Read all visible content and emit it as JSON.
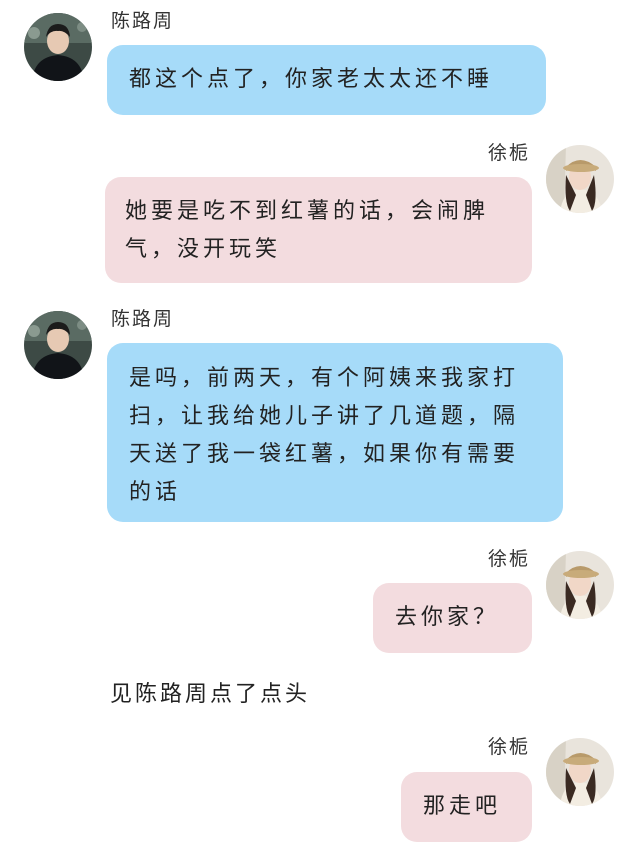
{
  "messages": [
    {
      "sender": "陈路周",
      "text": "都这个点了，你家老太太还不睡"
    },
    {
      "sender": "徐栀",
      "text": "她要是吃不到红薯的话，会闹脾气，没开玩笑"
    },
    {
      "sender": "陈路周",
      "text": "是吗，前两天，有个阿姨来我家打扫，让我给她儿子讲了几道题，隔天送了我一袋红薯，如果你有需要的话"
    },
    {
      "sender": "徐栀",
      "text": "去你家？"
    },
    {
      "narration": "见陈路周点了点头"
    },
    {
      "sender": "徐栀",
      "text": "那走吧"
    }
  ],
  "avatars": {
    "male": "male-avatar-photo",
    "female": "female-avatar-photo"
  },
  "colors": {
    "blue_bubble": "#a6dbf9",
    "pink_bubble": "#f3dcdf"
  }
}
